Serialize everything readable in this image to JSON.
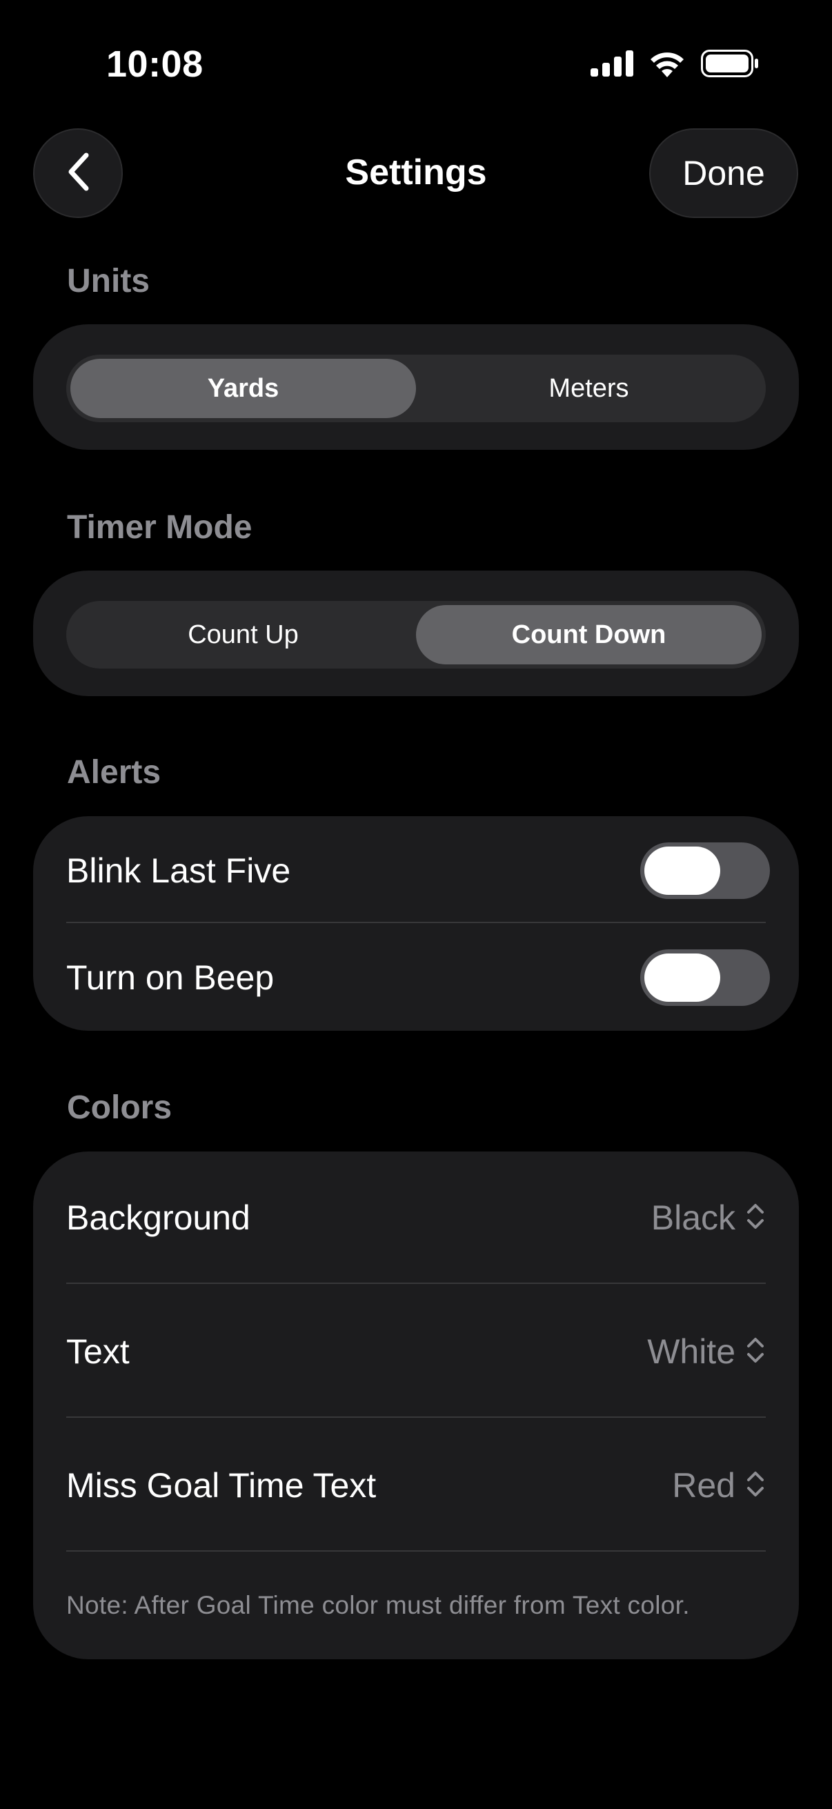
{
  "status_bar": {
    "time": "10:08"
  },
  "nav": {
    "title": "Settings",
    "done_label": "Done"
  },
  "units": {
    "header": "Units",
    "options": [
      "Yards",
      "Meters"
    ],
    "selected": "Yards"
  },
  "timer_mode": {
    "header": "Timer Mode",
    "options": [
      "Count Up",
      "Count Down"
    ],
    "selected": "Count Down"
  },
  "alerts": {
    "header": "Alerts",
    "items": [
      {
        "label": "Blink Last Five",
        "on": false
      },
      {
        "label": "Turn on Beep",
        "on": false
      }
    ]
  },
  "colors": {
    "header": "Colors",
    "items": [
      {
        "label": "Background",
        "value": "Black"
      },
      {
        "label": "Text",
        "value": "White"
      },
      {
        "label": "Miss Goal Time Text",
        "value": "Red"
      }
    ],
    "note": "Note: After Goal Time color must differ from Text color."
  },
  "theme": {
    "background": "#000000",
    "card": "#1c1c1e",
    "segment_track": "#2c2c2e",
    "segment_selected": "#636366",
    "secondary_text": "#8e8e93"
  }
}
